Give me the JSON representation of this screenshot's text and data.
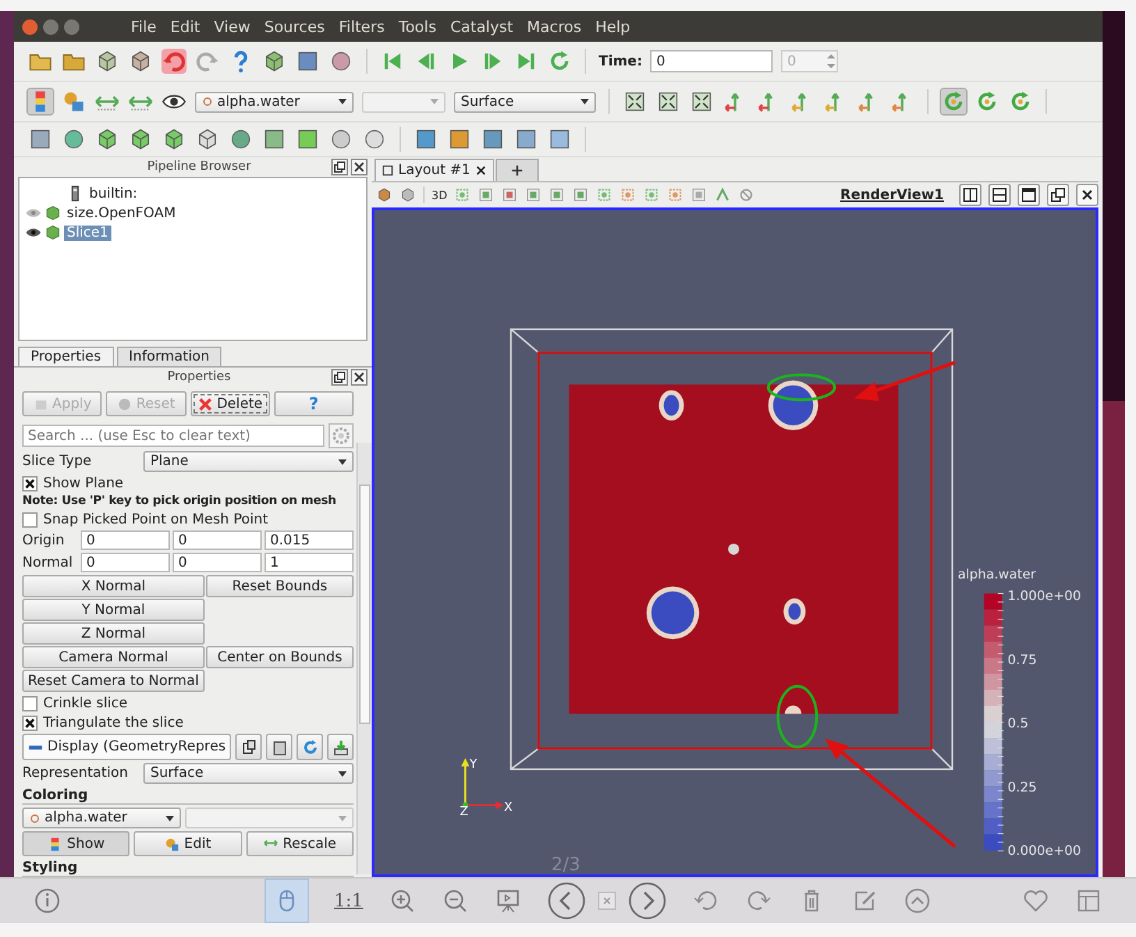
{
  "menu": [
    "File",
    "Edit",
    "View",
    "Sources",
    "Filters",
    "Tools",
    "Catalyst",
    "Macros",
    "Help"
  ],
  "time": {
    "label": "Time:",
    "value": "0",
    "step": "0"
  },
  "coloring_toolbar": {
    "array": "alpha.water",
    "representation": "Surface"
  },
  "pipeline_browser": {
    "title": "Pipeline Browser",
    "items": [
      {
        "label": "builtin:",
        "kind": "server",
        "selected": false
      },
      {
        "label": "size.OpenFOAM",
        "kind": "source",
        "visible": false,
        "selected": false
      },
      {
        "label": "Slice1",
        "kind": "source",
        "visible": true,
        "selected": true
      }
    ]
  },
  "panel_tabs": [
    {
      "label": "Properties",
      "selected": true
    },
    {
      "label": "Information",
      "selected": false
    }
  ],
  "properties": {
    "title": "Properties",
    "buttons": [
      {
        "label": "Apply",
        "kind": "apply",
        "disabled": true
      },
      {
        "label": "Reset",
        "kind": "reset",
        "disabled": true
      },
      {
        "label": "Delete",
        "kind": "delete",
        "disabled": false
      },
      {
        "label": "?",
        "kind": "help",
        "disabled": false
      }
    ],
    "search_placeholder": "Search ... (use Esc to clear text)",
    "slice_type": {
      "label": "Slice Type",
      "value": "Plane"
    },
    "show_plane": {
      "label": "Show Plane",
      "checked": true
    },
    "note": "Note: Use 'P' key to pick origin position on mesh",
    "snap": {
      "label": "Snap Picked Point on Mesh Point",
      "checked": false
    },
    "origin": {
      "label": "Origin",
      "values": [
        "0",
        "0",
        "0.015"
      ]
    },
    "normal": {
      "label": "Normal",
      "values": [
        "0",
        "0",
        "1"
      ]
    },
    "plane_buttons": [
      [
        "X Normal",
        "Reset Bounds"
      ],
      [
        "Y Normal"
      ],
      [
        "Z Normal"
      ],
      [
        "Camera Normal",
        "Center on Bounds"
      ],
      [
        "Reset Camera to Normal"
      ]
    ],
    "crinkle": {
      "label": "Crinkle slice",
      "checked": false
    },
    "triangulate": {
      "label": "Triangulate the slice",
      "checked": true
    },
    "display": "Display (GeometryRepres",
    "representation": {
      "label": "Representation",
      "value": "Surface"
    },
    "coloring": {
      "title": "Coloring",
      "array": "alpha.water",
      "buttons": [
        "Show",
        "Edit",
        "Rescale"
      ]
    },
    "styling_title": "Styling"
  },
  "layout_tabs": [
    {
      "label": "Layout #1",
      "selected": true
    }
  ],
  "render_view": {
    "mode": "3D",
    "title": "RenderView1",
    "legend": {
      "title": "alpha.water",
      "labels": [
        "1.000e+00",
        "0.75",
        "0.5",
        "0.25",
        "0.000e+00"
      ]
    },
    "axes": {
      "x": "X",
      "y": "Y",
      "z": "Z"
    }
  },
  "viewer": {
    "page": "2/3",
    "zoom_reset": "1:1"
  }
}
